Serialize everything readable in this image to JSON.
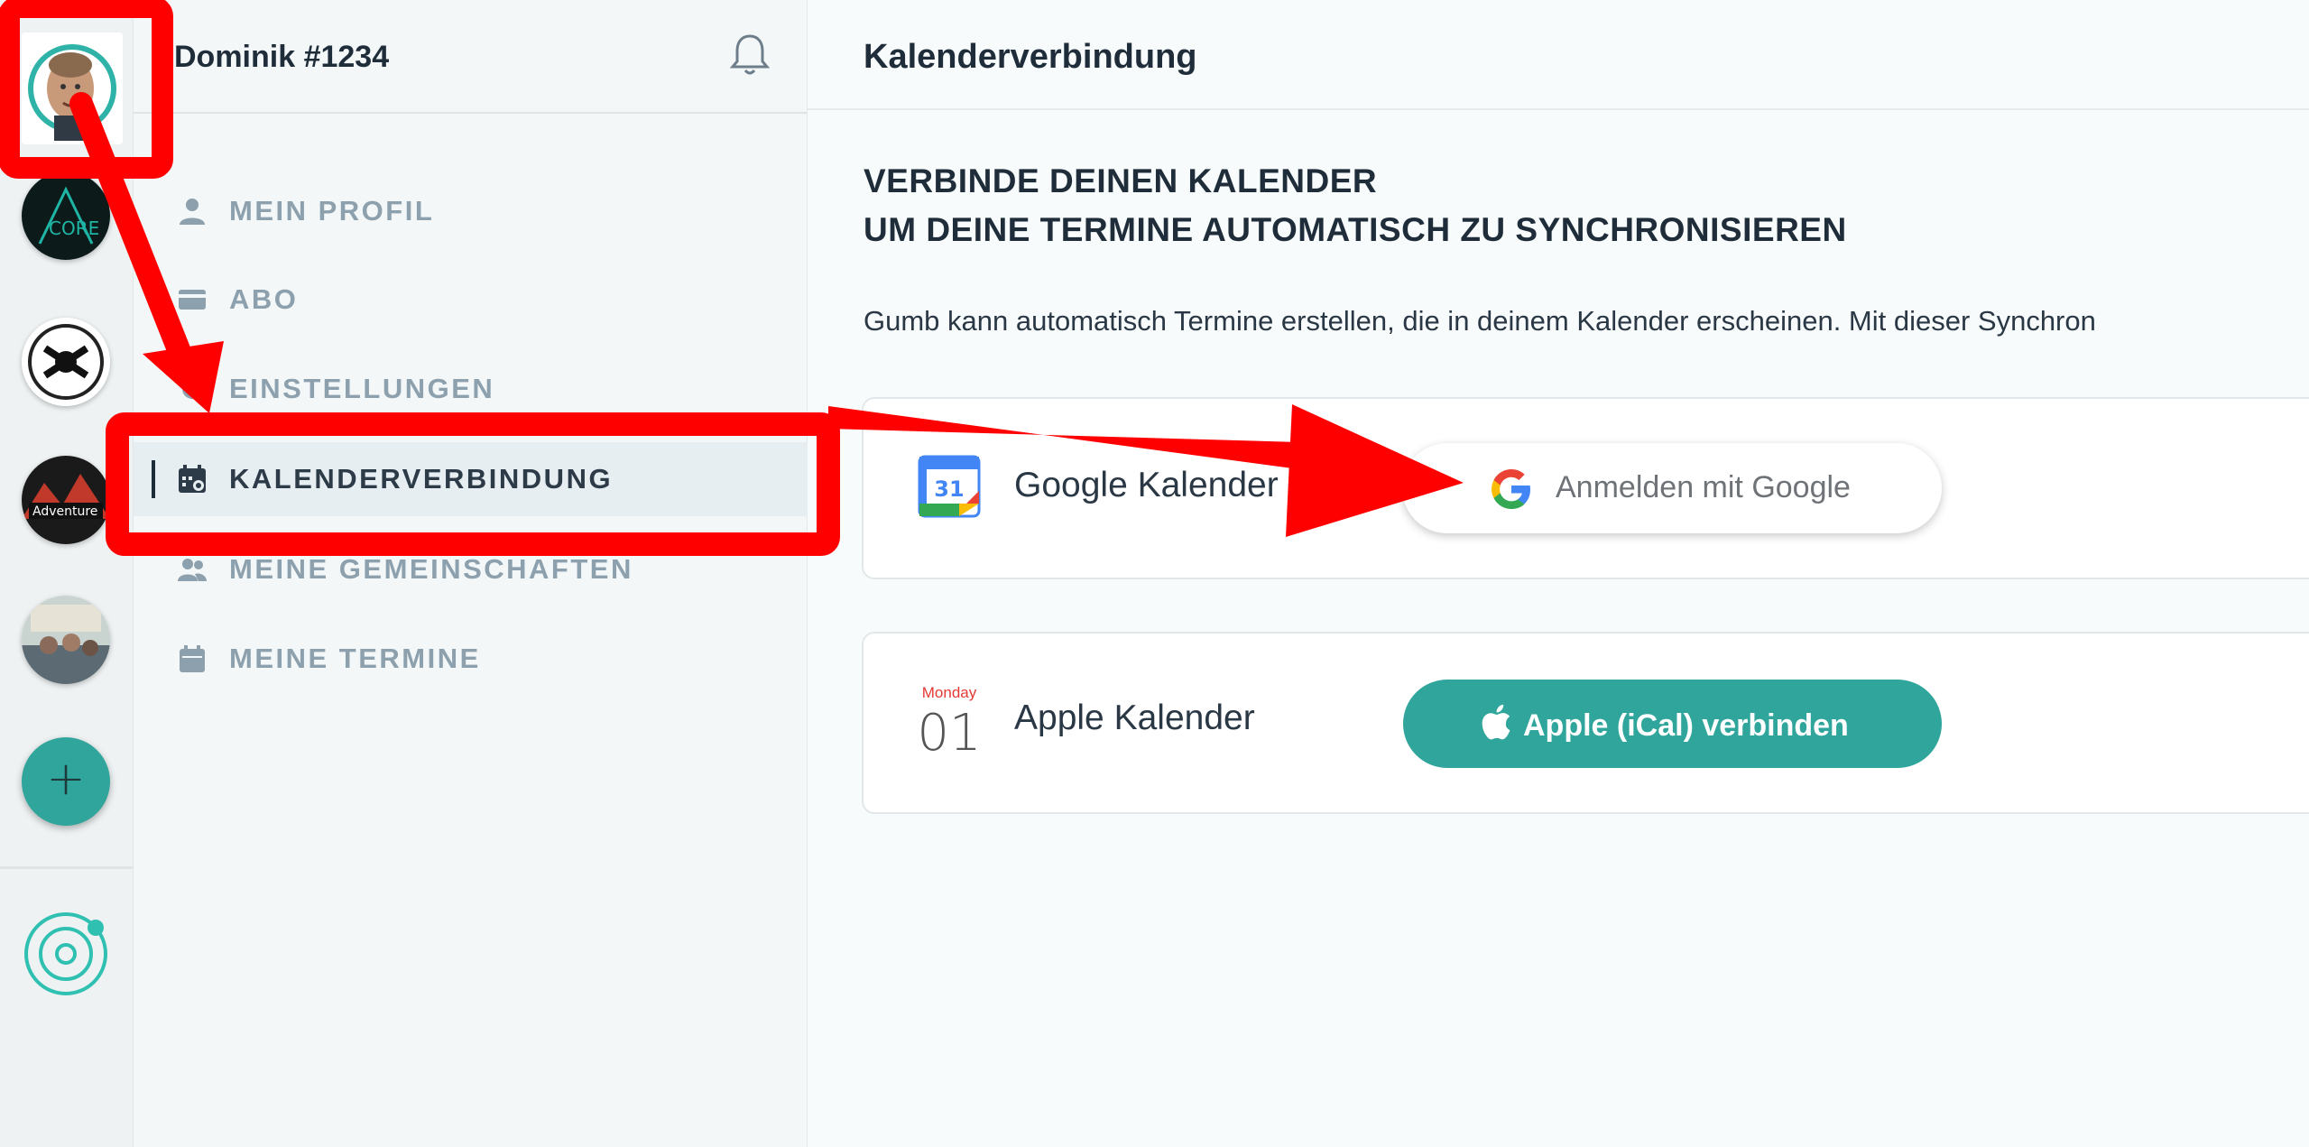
{
  "user": {
    "name": "Dominik #1234"
  },
  "rail": {
    "communities": [
      "avatar-self",
      "core-community",
      "tools-community",
      "adventure-community",
      "group-photo-community"
    ],
    "add_label": "+"
  },
  "nav": {
    "items": [
      {
        "label": "MEIN PROFIL",
        "icon": "person-icon",
        "active": false
      },
      {
        "label": "ABO",
        "icon": "card-icon",
        "active": false
      },
      {
        "label": "EINSTELLUNGEN",
        "icon": "gear-icon",
        "active": false
      },
      {
        "label": "KALENDERVERBINDUNG",
        "icon": "calendar-sync-icon",
        "active": true
      },
      {
        "label": "MEINE GEMEINSCHAFTEN",
        "icon": "people-icon",
        "active": false
      },
      {
        "label": "MEINE TERMINE",
        "icon": "calendar-icon",
        "active": false
      }
    ]
  },
  "main": {
    "title": "Kalenderverbindung",
    "heading_line1": "VERBINDE DEINEN KALENDER",
    "heading_line2": "UM DEINE TERMINE AUTOMATISCH ZU SYNCHRONISIEREN",
    "intro": "Gumb kann automatisch Termine erstellen, die in deinem Kalender erscheinen. Mit dieser Synchron",
    "google": {
      "name": "Google Kalender",
      "icon_day": "31",
      "button_label": "Anmelden mit Google"
    },
    "apple": {
      "name": "Apple Kalender",
      "icon_weekday": "Monday",
      "icon_day": "01",
      "button_label": "Apple (iCal) verbinden"
    }
  },
  "colors": {
    "accent": "#2fa59c",
    "annotation": "#ff0000",
    "nav_muted": "#8ca0ad",
    "text_dark": "#1f2d3a"
  }
}
